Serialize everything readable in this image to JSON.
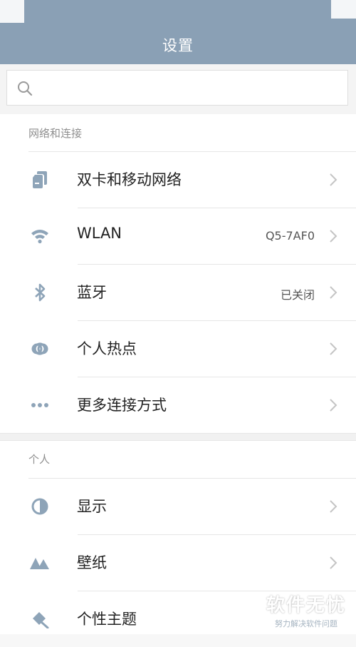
{
  "header": {
    "title": "设置"
  },
  "search": {
    "placeholder": ""
  },
  "sections": [
    {
      "title": "网络和连接",
      "items": [
        {
          "icon": "sim-card-icon",
          "label": "双卡和移动网络",
          "value": ""
        },
        {
          "icon": "wifi-icon",
          "label": "WLAN",
          "value": "Q5-7AF0"
        },
        {
          "icon": "bluetooth-icon",
          "label": "蓝牙",
          "value": "已关闭"
        },
        {
          "icon": "hotspot-icon",
          "label": "个人热点",
          "value": ""
        },
        {
          "icon": "more-dots-icon",
          "label": "更多连接方式",
          "value": ""
        }
      ]
    },
    {
      "title": "个人",
      "items": [
        {
          "icon": "display-icon",
          "label": "显示",
          "value": ""
        },
        {
          "icon": "wallpaper-icon",
          "label": "壁纸",
          "value": ""
        },
        {
          "icon": "theme-icon",
          "label": "个性主题",
          "value": ""
        }
      ]
    }
  ],
  "watermark": {
    "main": "软件无忧",
    "sub": "努力解决软件问题"
  },
  "colors": {
    "header": "#8aa0b5",
    "icon": "#8ea4b8",
    "chevron": "#c4c4c4"
  }
}
